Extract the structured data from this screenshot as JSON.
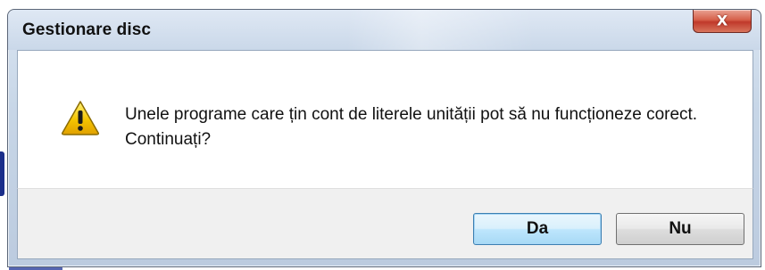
{
  "window": {
    "title": "Gestionare disc"
  },
  "titlebar": {
    "close_icon": "close-icon",
    "close_glyph": "X"
  },
  "message": {
    "icon": "warning-icon",
    "text": "Unele programe care țin cont de literele unității pot să nu funcționeze corect. Continuați?"
  },
  "buttons": {
    "yes_label": "Da",
    "no_label": "Nu"
  },
  "colors": {
    "warning_fill": "#f5c400",
    "warning_border": "#8a6b00",
    "close_button": "#c0392b",
    "default_button_border": "#3c7fb1"
  }
}
